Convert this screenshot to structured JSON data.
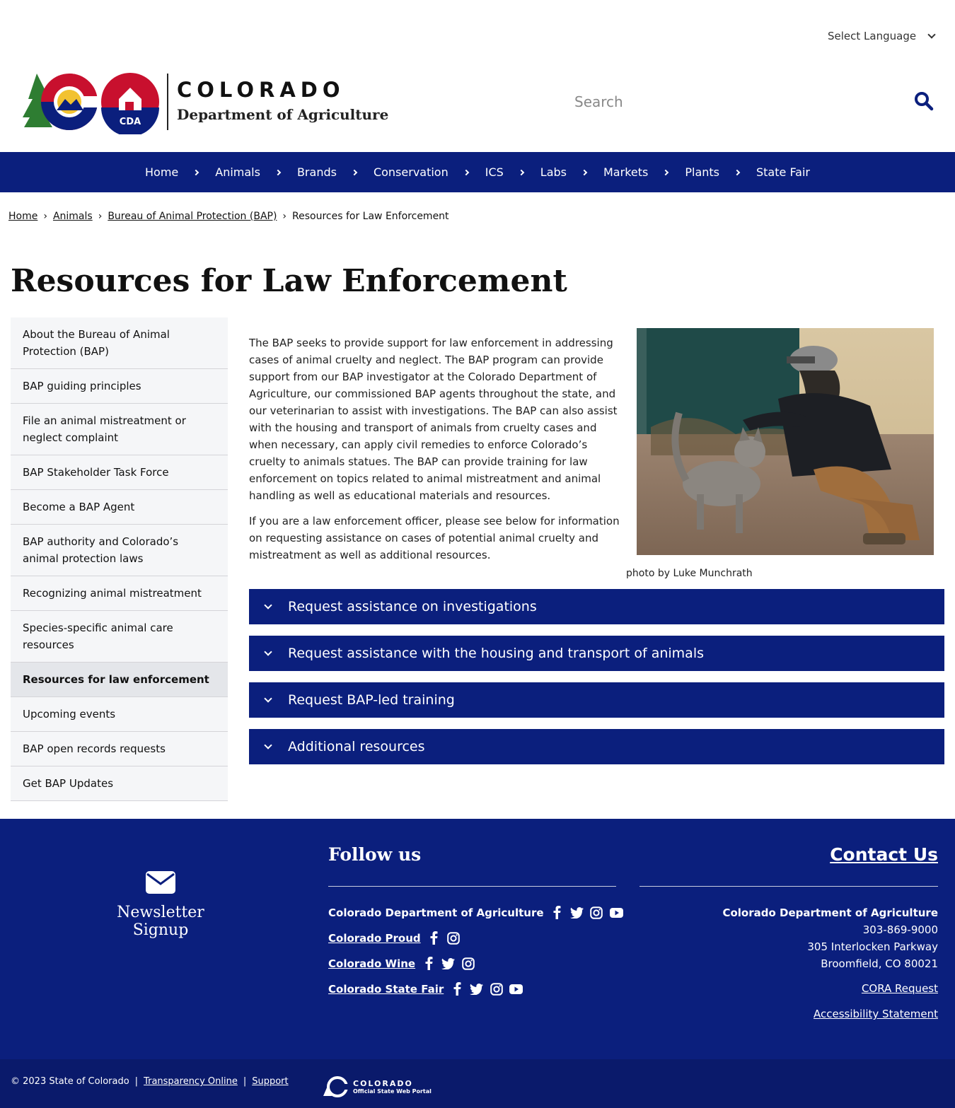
{
  "language": {
    "label": "Select Language"
  },
  "brand": {
    "title": "COLORADO",
    "subtitle": "Department of Agriculture",
    "cda": "CDA"
  },
  "search": {
    "placeholder": "Search"
  },
  "nav": [
    "Home",
    "Animals",
    "Brands",
    "Conservation",
    "ICS",
    "Labs",
    "Markets",
    "Plants",
    "State Fair"
  ],
  "breadcrumb": {
    "home": "Home",
    "animals": "Animals",
    "bap": "Bureau of Animal Protection (BAP)",
    "current": "Resources for Law Enforcement",
    "sep": "›"
  },
  "page_title": "Resources for Law Enforcement",
  "sidebar": [
    "About the Bureau of Animal Protection (BAP)",
    "BAP guiding principles",
    "File an animal mistreatment or neglect complaint",
    "BAP Stakeholder Task Force",
    "Become a BAP Agent",
    "BAP authority and Colorado’s animal protection laws",
    "Recognizing animal mistreatment",
    "Species-specific animal care resources",
    "Resources for law enforcement",
    "Upcoming events",
    "BAP open records requests",
    "Get BAP Updates"
  ],
  "sidebar_active_index": 8,
  "content": {
    "p1": "The BAP seeks to provide support for law enforcement in addressing cases of animal cruelty and neglect. The BAP program can provide support from our BAP investigator at the Colorado Department of Agriculture, our commissioned BAP agents throughout the state, and our veterinarian to assist with investigations. The BAP can also assist with the housing and transport of animals from cruelty cases and when necessary, can apply civil remedies to enforce Colorado’s cruelty to animals statues. The BAP can provide training for law enforcement on topics related to animal mistreatment and animal handling as well as educational materials and resources.",
    "p2": "If you are a law enforcement officer, please see below for information on requesting assistance on cases of potential animal cruelty and mistreatment as well as additional resources.",
    "caption": "photo by Luke Munchrath"
  },
  "accordions": [
    "Request assistance on investigations",
    "Request assistance with the housing and transport of animals",
    "Request BAP-led training",
    "Additional resources"
  ],
  "footer": {
    "newsletter": "Newsletter Signup",
    "follow_title": "Follow us",
    "follow": [
      {
        "name": "Colorado Department of Agriculture",
        "icons": [
          "facebook-icon",
          "twitter-icon",
          "instagram-icon",
          "youtube-icon"
        ]
      },
      {
        "name": "Colorado Proud",
        "icons": [
          "facebook-icon",
          "instagram-icon"
        ]
      },
      {
        "name": "Colorado Wine",
        "icons": [
          "facebook-icon",
          "twitter-icon",
          "instagram-icon"
        ]
      },
      {
        "name": "Colorado State Fair",
        "icons": [
          "facebook-icon",
          "twitter-icon",
          "instagram-icon",
          "youtube-icon"
        ]
      }
    ],
    "contact_title": "Contact Us",
    "org": "Colorado Department of Agriculture",
    "phone": "303-869-9000",
    "address1": "305 Interlocken Parkway",
    "address2": "Broomfield, CO 80021",
    "cora": "CORA Request",
    "accessibility": "Accessibility Statement"
  },
  "bottom": {
    "copyright": "© 2023 State of Colorado",
    "pipe": "|",
    "transparency": "Transparency Online",
    "support": "Support",
    "portal_title": "COLORADO",
    "portal_sub": "Official State Web Portal"
  },
  "colors": {
    "navy": "#0b1f7d",
    "red": "#c8102e",
    "gold": "#f2c230",
    "green": "#2e7d32"
  }
}
